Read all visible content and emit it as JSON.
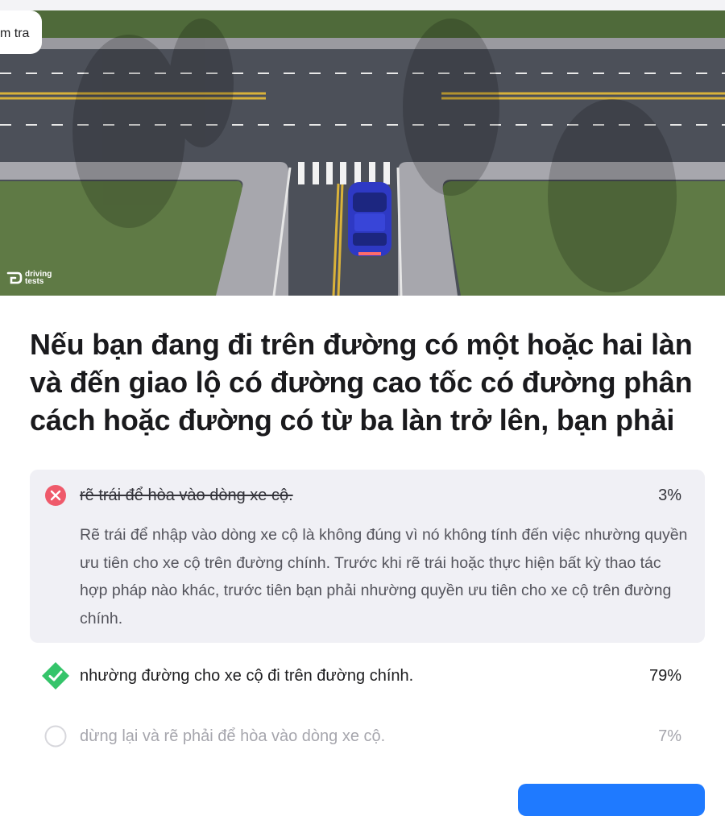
{
  "header": {
    "back_label": "m tra"
  },
  "illustration": {
    "brand_text": "driving\ntests",
    "icon": "car-intersection-illustration"
  },
  "question": {
    "text": "Nếu bạn đang đi trên đường có một hoặc hai làn và đến giao lộ có đường cao tốc có đường phân cách hoặc đường có từ ba làn trở lên, bạn phải"
  },
  "options": [
    {
      "status": "wrong",
      "icon": "x-circle-icon",
      "label": "rẽ trái để hòa vào dòng xe cộ.",
      "percent": "3%",
      "explanation": "Rẽ trái để nhập vào dòng xe cộ là không đúng vì nó không tính đến việc nhường quyền ưu tiên cho xe cộ trên đường chính. Trước khi rẽ trái hoặc thực hiện bất kỳ thao tác hợp pháp nào khác, trước tiên bạn phải nhường quyền ưu tiên cho xe cộ trên đường chính."
    },
    {
      "status": "correct",
      "icon": "check-diamond-icon",
      "label": "nhường đường cho xe cộ đi trên đường chính.",
      "percent": "79%"
    },
    {
      "status": "neutral",
      "icon": "empty-circle-icon",
      "label": "dừng lại và rẽ phải để hòa vào dòng xe cộ.",
      "percent": "7%"
    }
  ],
  "colors": {
    "wrong": "#ef5a6b",
    "correct": "#35c46a",
    "accent": "#1f7aff",
    "answer_bg": "#f0f0f5"
  }
}
